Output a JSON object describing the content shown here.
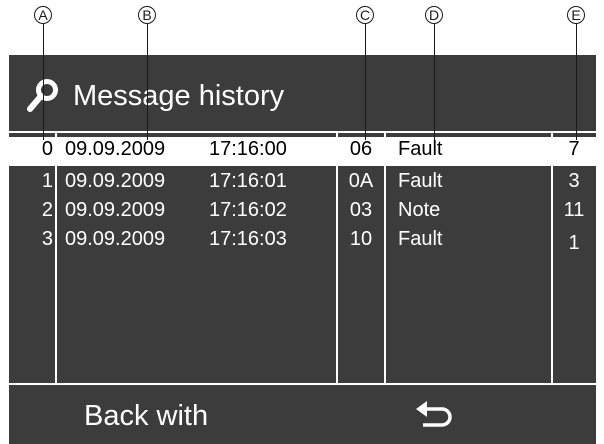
{
  "callouts": [
    "A",
    "B",
    "C",
    "D",
    "E"
  ],
  "header": {
    "title": "Message history",
    "icon": "wrench-icon"
  },
  "rows": [
    {
      "index": "0",
      "date": "09.09.2009",
      "time": "17:16:00",
      "code": "06",
      "type": "Fault",
      "count": "7",
      "selected": true
    },
    {
      "index": "1",
      "date": "09.09.2009",
      "time": "17:16:01",
      "code": "0A",
      "type": "Fault",
      "count": "3",
      "selected": false
    },
    {
      "index": "2",
      "date": "09.09.2009",
      "time": "17:16:02",
      "code": "03",
      "type": "Note",
      "count": "11",
      "selected": false
    },
    {
      "index": "3",
      "date": "09.09.2009",
      "time": "17:16:03",
      "code": "10",
      "type": "Fault",
      "count": "1",
      "selected": false
    }
  ],
  "footer": {
    "label": "Back with",
    "icon": "return-arrow-icon"
  },
  "colors": {
    "screen": "#3c3c3c",
    "text": "#ffffff",
    "selected_row_background": "#ffffff",
    "selected_row_text": "#000000"
  }
}
